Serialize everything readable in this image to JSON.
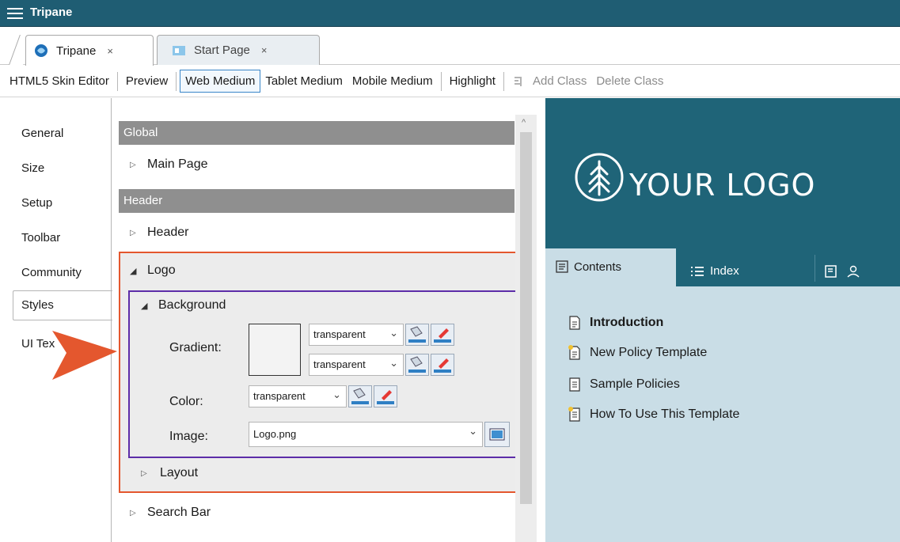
{
  "window": {
    "title": "Tripane"
  },
  "tabs": [
    {
      "label": "Tripane",
      "close": "×"
    },
    {
      "label": "Start Page",
      "close": "×"
    }
  ],
  "toolbar": {
    "items": [
      "HTML5 Skin Editor",
      "Preview",
      "Web Medium",
      "Tablet Medium",
      "Mobile Medium",
      "Highlight"
    ],
    "add_class": "Add Class",
    "delete_class": "Delete Class"
  },
  "leftnav": {
    "items": [
      "General",
      "Size",
      "Setup",
      "Toolbar",
      "Community",
      "Styles",
      "UI Tex"
    ]
  },
  "styles": {
    "global_header": "Global",
    "main_page": "Main Page",
    "header_section": "Header",
    "header_item": "Header",
    "logo": "Logo",
    "background": "Background",
    "gradient_label": "Gradient:",
    "gradient_top": "transparent",
    "gradient_bottom": "transparent",
    "color_label": "Color:",
    "color_value": "transparent",
    "image_label": "Image:",
    "image_value": "Logo.png",
    "layout": "Layout",
    "search_bar": "Search Bar"
  },
  "preview": {
    "logo_text": "YOUR LOGO",
    "tab_contents": "Contents",
    "tab_index": "Index",
    "toc": [
      "Introduction",
      "New Policy Template",
      "Sample Policies",
      "How To Use This Template"
    ]
  },
  "colors": {
    "title_bar": "#1f5d73",
    "preview_header": "#1f6478",
    "preview_body": "#c9dde6",
    "highlight_red": "#e4572e",
    "highlight_purple": "#5c2da8"
  }
}
